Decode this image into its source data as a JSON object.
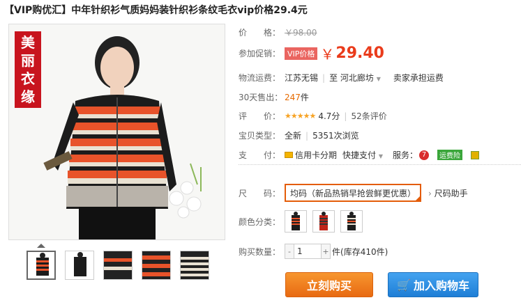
{
  "title": "【VIP购优汇】中年针织衫气质妈妈装针织衫条纹毛衣vip价格29.4元",
  "image_badge": [
    "美",
    "丽",
    "衣",
    "缘"
  ],
  "price": {
    "label": "价　　格：",
    "old": "￥98.00"
  },
  "promo": {
    "label": "参加促销：",
    "tag": "VIP价格",
    "yen": "￥",
    "value": "29.40"
  },
  "shipping": {
    "label": "物流运费：",
    "from": "江苏无锡",
    "to_word": "至",
    "to": "河北廊坊",
    "fee": "卖家承担运费"
  },
  "sales": {
    "label": "30天售出：",
    "count": "247",
    "unit": "件"
  },
  "rating": {
    "label": "评　　价：",
    "stars": "★★★★★",
    "score": "4.7分",
    "reviews": "52条评价"
  },
  "type": {
    "label": "宝贝类型：",
    "value": "全新",
    "views": "5351次浏览"
  },
  "payment": {
    "label": "支　　付：",
    "credit": "信用卡分期",
    "quick": "快捷支付",
    "service_label": "服务：",
    "service_badge": "运费险"
  },
  "size": {
    "label": "尺　　码：",
    "selected": "均码（新品热销早抢尝鲜更优惠）",
    "helper": "尺码助手"
  },
  "color": {
    "label": "颜色分类："
  },
  "quantity": {
    "label": "购买数量：",
    "value": "1",
    "unit": "件",
    "stock": "(库存410件)"
  },
  "actions": {
    "buy": "立刻购买",
    "cart": "加入购物车"
  },
  "colors": {
    "accent": "#ea3b1b",
    "buy": "#f07b1e",
    "cart": "#2a8de3"
  }
}
